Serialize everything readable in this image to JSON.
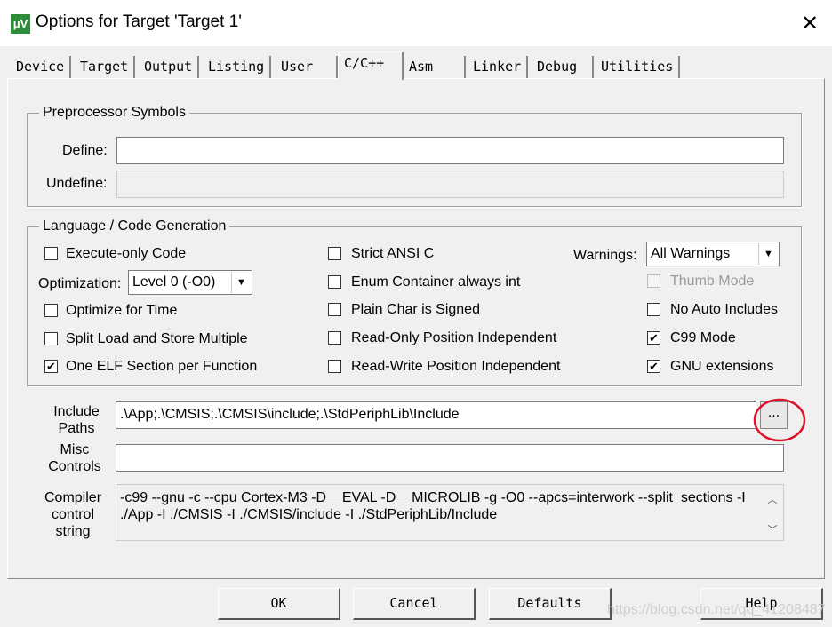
{
  "window": {
    "title": "Options for Target 'Target 1'",
    "close": "✕",
    "icon_text": "μV"
  },
  "tabs": [
    "Device",
    "Target",
    "Output",
    "Listing",
    "User",
    "C/C++",
    "Asm",
    "Linker",
    "Debug",
    "Utilities"
  ],
  "active_tab": "C/C++",
  "preprocessor": {
    "legend": "Preprocessor Symbols",
    "define_label": "Define:",
    "define_value": "",
    "undefine_label": "Undefine:",
    "undefine_value": ""
  },
  "language": {
    "legend": "Language / Code Generation",
    "execute_only": {
      "label": "Execute-only Code",
      "checked": false
    },
    "optimization_label": "Optimization:",
    "optimization_value": "Level 0 (-O0)",
    "optimize_time": {
      "label": "Optimize for Time",
      "checked": false
    },
    "split_load": {
      "label": "Split Load and Store Multiple",
      "checked": false
    },
    "one_elf": {
      "label": "One ELF Section per Function",
      "checked": true
    },
    "strict_ansi": {
      "label": "Strict ANSI C",
      "checked": false
    },
    "enum_int": {
      "label": "Enum Container always int",
      "checked": false
    },
    "plain_char": {
      "label": "Plain Char is Signed",
      "checked": false
    },
    "ro_pi": {
      "label": "Read-Only Position Independent",
      "checked": false
    },
    "rw_pi": {
      "label": "Read-Write Position Independent",
      "checked": false
    },
    "warnings_label": "Warnings:",
    "warnings_value": "All Warnings",
    "thumb": {
      "label": "Thumb Mode",
      "checked": false,
      "disabled": true
    },
    "no_auto": {
      "label": "No Auto Includes",
      "checked": false
    },
    "c99": {
      "label": "C99 Mode",
      "checked": true
    },
    "gnu": {
      "label": "GNU extensions",
      "checked": true
    }
  },
  "include_paths": {
    "label1": "Include",
    "label2": "Paths",
    "value": ".\\App;.\\CMSIS;.\\CMSIS\\include;.\\StdPeriphLib\\Include",
    "browse": "..."
  },
  "misc": {
    "label1": "Misc",
    "label2": "Controls",
    "value": ""
  },
  "compiler": {
    "label1": "Compiler",
    "label2": "control",
    "label3": "string",
    "line1": "-c99 --gnu -c --cpu Cortex-M3 -D__EVAL -D__MICROLIB -g -O0 --apcs=interwork --split_sections -I",
    "line2": "./App -I ./CMSIS -I ./CMSIS/include -I ./StdPeriphLib/Include"
  },
  "buttons": {
    "ok": "OK",
    "cancel": "Cancel",
    "defaults": "Defaults",
    "help": "Help"
  },
  "watermark": "https://blog.csdn.net/qq_41208487",
  "annotation_color": "#e0102a"
}
